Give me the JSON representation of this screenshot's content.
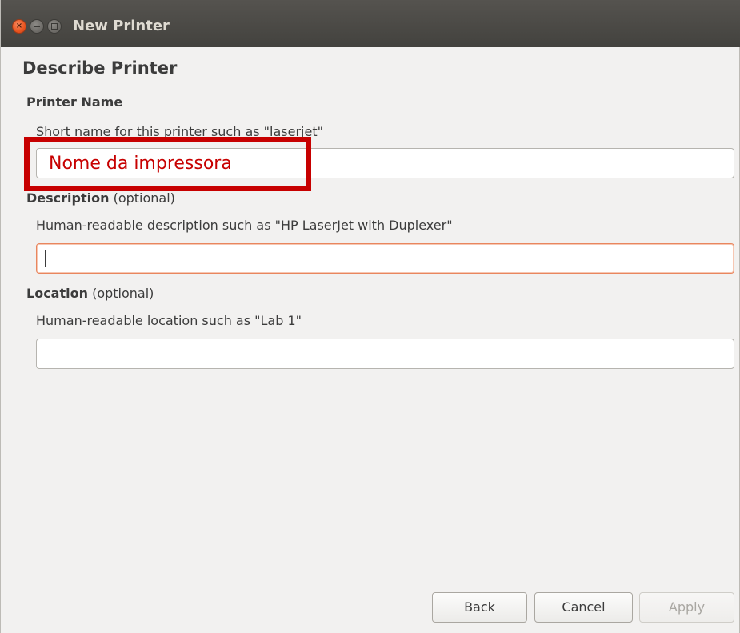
{
  "window": {
    "title": "New Printer"
  },
  "page": {
    "heading": "Describe Printer"
  },
  "printer_name": {
    "label": "Printer Name",
    "hint": "Short name for this printer such as \"laserjet\"",
    "value": ""
  },
  "description": {
    "label": "Description",
    "optional": " (optional)",
    "hint": "Human-readable description such as \"HP LaserJet with Duplexer\"",
    "value": ""
  },
  "location": {
    "label": "Location",
    "optional": " (optional)",
    "hint": "Human-readable location such as \"Lab 1\"",
    "value": ""
  },
  "annotation": {
    "text": "Nome da impressora",
    "color": "#c70000"
  },
  "buttons": {
    "back": "Back",
    "cancel": "Cancel",
    "apply": "Apply"
  },
  "colors": {
    "titlebar": "#4a4945",
    "window_bg": "#f2f1f0",
    "close_button": "#e9541f",
    "focus_border": "#e9865e"
  },
  "icons": {
    "close": "close-icon",
    "minimize": "minimize-icon",
    "maximize": "maximize-icon"
  }
}
